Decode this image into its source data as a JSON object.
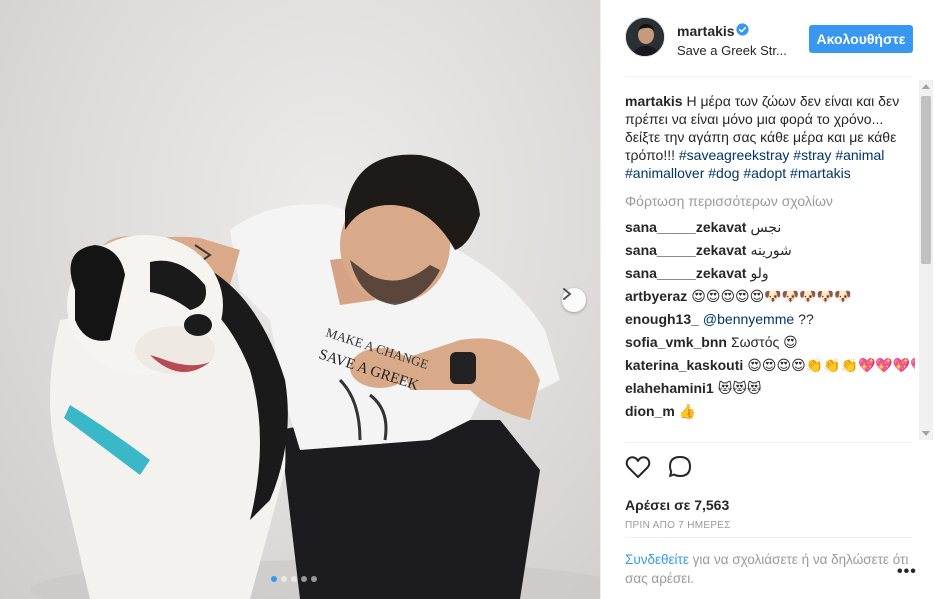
{
  "post": {
    "username": "martakis",
    "location": "Save a Greek Str...",
    "follow_label": "Ακολουθήστε",
    "caption_user": "martakis",
    "caption_text": "Η μέρα των ζώων δεν είναι και δεν πρέπει να είναι μόνο μια φορά το χρόνο... δείξτε την αγάπη σας κάθε μέρα και με κάθε τρόπο!!!",
    "caption_tags": [
      "#saveagreekstray",
      "#stray",
      "#animal",
      "#animallover",
      "#dog",
      "#adopt",
      "#martakis"
    ],
    "load_more": "Φόρτωση περισσότερων σχολίων",
    "comments": [
      {
        "user": "sana_____zekavat",
        "text": "نجس"
      },
      {
        "user": "sana_____zekavat",
        "text": "شورینه"
      },
      {
        "user": "sana_____zekavat",
        "text": "ولو"
      },
      {
        "user": "artbyeraz",
        "text": "😍😍😍😍😍🐶🐶🐶🐶🐶"
      },
      {
        "user": "enough13_",
        "mention": "@bennyemme",
        "text": "??"
      },
      {
        "user": "sofia_vmk_bnn",
        "text": "Σωστός 😍"
      },
      {
        "user": "katerina_kaskouti",
        "text": "😍😍😍😍👏👏👏💖💖💖💖💖"
      },
      {
        "user": "elahehamini1",
        "text": "😻😻😻"
      },
      {
        "user": "dion_m",
        "text": "👍"
      }
    ],
    "likes": "Αρέσει σε 7,563",
    "time_ago": "ΠΡΙΝ ΑΠΟ 7 ΗΜΕΡΕΣ",
    "footer_login": "Συνδεθείτε",
    "footer_text": " για να σχολιάσετε ή να δηλώσετε ότι σας αρέσει.",
    "more_options": "•••"
  },
  "photo": {
    "shirt_text_1": "MAKE A CHANGE",
    "shirt_text_2": "SAVE A GREEK",
    "carousel_dots": 5,
    "active_dot": 0
  },
  "colors": {
    "accent": "#3897f0",
    "hashtag": "#003569",
    "muted": "#999999"
  },
  "icons": {
    "verified": "verified-badge-icon",
    "like": "heart-icon",
    "comment": "comment-bubble-icon",
    "next": "chevron-right-icon"
  }
}
